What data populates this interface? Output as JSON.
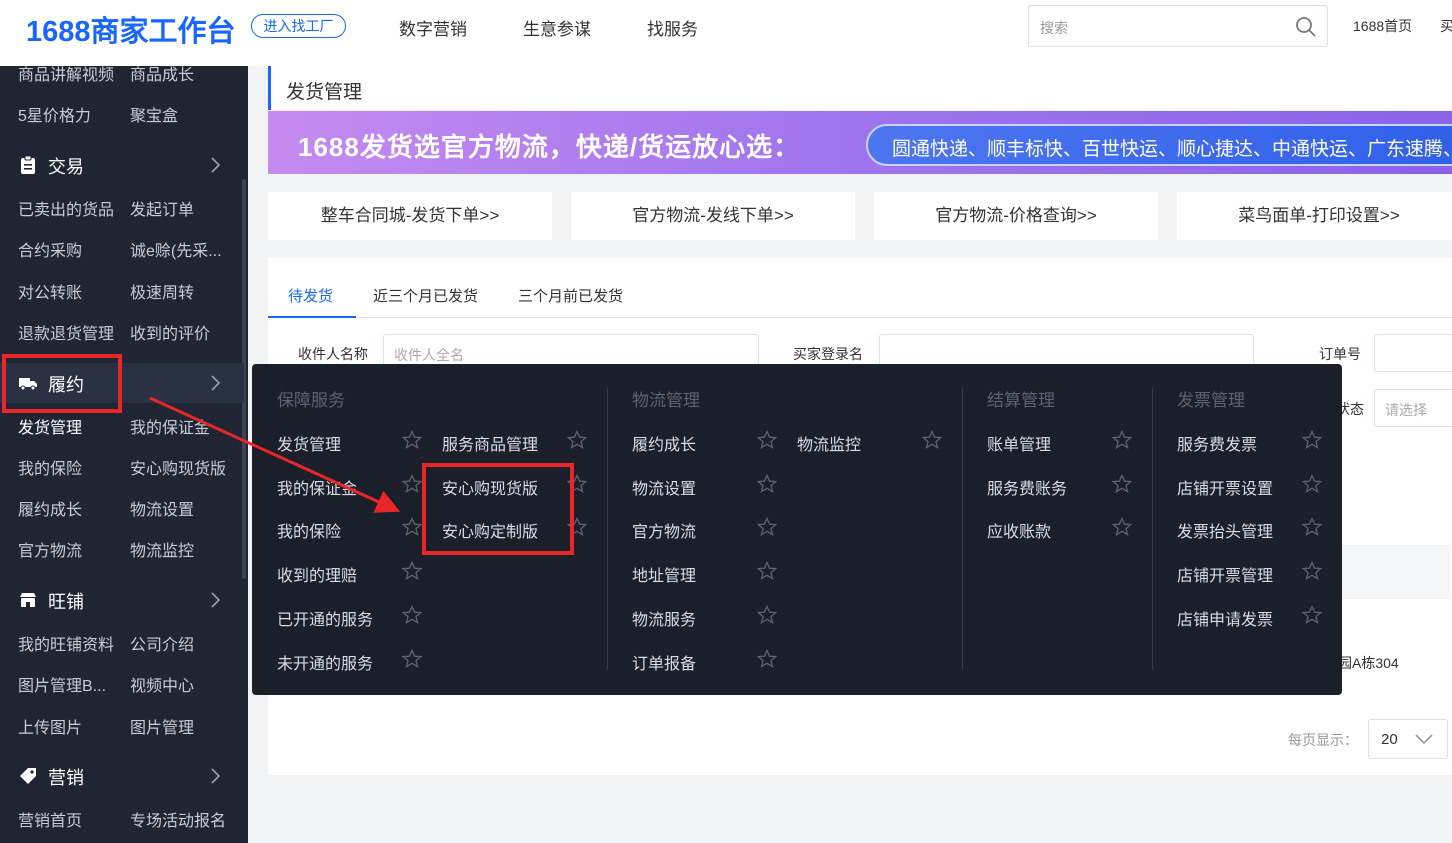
{
  "header": {
    "logo": "1688商家工作台",
    "enter_factory": "进入找工厂",
    "nav": [
      "数字营销",
      "生意参谋",
      "找服务"
    ],
    "search_placeholder": "搜索",
    "home_link": "1688首页",
    "cut_link": "买"
  },
  "sidebar": {
    "top_partial": [
      "商品讲解视频",
      "商品成长"
    ],
    "row_5star": [
      "5星价格力",
      "聚宝盒"
    ],
    "sections": [
      {
        "title": "交易",
        "icon": "clipboard-icon",
        "rows": [
          [
            "已卖出的货品",
            "发起订单"
          ],
          [
            "合约采购",
            "诚e赊(先采..."
          ],
          [
            "对公转账",
            "极速周转"
          ],
          [
            "退款退货管理",
            "收到的评价"
          ]
        ]
      },
      {
        "title": "履约",
        "icon": "truck-icon",
        "rows": [
          [
            "发货管理",
            "我的保证金"
          ],
          [
            "我的保险",
            "安心购现货版"
          ],
          [
            "履约成长",
            "物流设置"
          ],
          [
            "官方物流",
            "物流监控"
          ]
        ]
      },
      {
        "title": "旺铺",
        "icon": "shop-icon",
        "rows": [
          [
            "我的旺铺资料",
            "公司介绍"
          ],
          [
            "图片管理B...",
            "视频中心"
          ],
          [
            "上传图片",
            "图片管理"
          ]
        ]
      },
      {
        "title": "营销",
        "icon": "tag-icon",
        "rows": [
          [
            "营销首页",
            "专场活动报名"
          ]
        ]
      }
    ]
  },
  "main": {
    "page_title": "发货管理",
    "banner": {
      "headline": "1688发货选官方物流，快递/货运放心选：",
      "carriers": "圆通快递、顺丰标快、百世快运、顺心捷达、中通快运、广东速腾、壹米滴答"
    },
    "quick_buttons": [
      "整车合同城-发货下单>>",
      "官方物流-发线下单>>",
      "官方物流-价格查询>>",
      "菜鸟面单-打印设置>>"
    ],
    "tabs": [
      "待发货",
      "近三个月已发货",
      "三个月前已发货"
    ],
    "filters": {
      "receiver_label": "收件人名称",
      "receiver_placeholder": "收件人全名",
      "buyer_label": "买家登录名",
      "order_label": "订单号",
      "status_label": "状态",
      "status_placeholder": "请选择"
    },
    "address_partial": "园A栋304",
    "pager": {
      "label": "每页显示：",
      "value": "20"
    }
  },
  "flyout": {
    "columns": [
      {
        "heading": "保障服务",
        "items": [
          "发货管理",
          "我的保证金",
          "我的保险",
          "收到的理赔",
          "已开通的服务",
          "未开通的服务"
        ]
      },
      {
        "heading": "",
        "items": [
          "服务商品管理",
          "安心购现货版",
          "安心购定制版"
        ]
      },
      {
        "heading": "物流管理",
        "items": [
          "履约成长",
          "物流设置",
          "官方物流",
          "地址管理",
          "物流服务",
          "订单报备"
        ]
      },
      {
        "heading": "",
        "items": [
          "物流监控"
        ]
      },
      {
        "heading": "结算管理",
        "items": [
          "账单管理",
          "服务费账务",
          "应收账款"
        ]
      },
      {
        "heading": "发票管理",
        "items": [
          "服务费发票",
          "店铺开票设置",
          "发票抬头管理",
          "店铺开票管理",
          "店铺申请发票"
        ]
      }
    ]
  },
  "colors": {
    "brand": "#1766ff",
    "sidebar_bg": "#1f2532",
    "flyout_bg": "#1b1f2a",
    "annotation": "#e8262a"
  }
}
